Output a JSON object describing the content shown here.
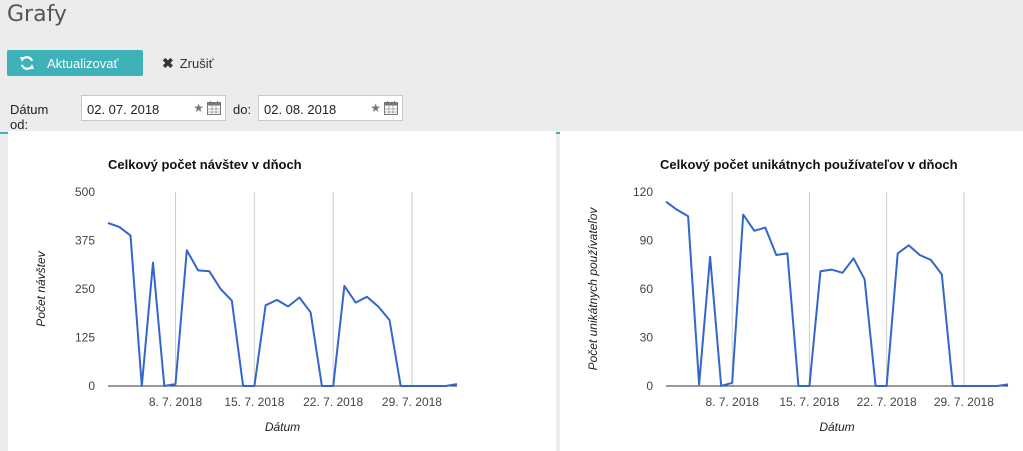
{
  "page": {
    "title": "Grafy"
  },
  "toolbar": {
    "refresh_label": "Aktualizovať",
    "cancel_label": "Zrušiť"
  },
  "filters": {
    "from_label": "Dátum od:",
    "from_value": "02. 07. 2018",
    "to_label": "do:",
    "to_value": "02. 08. 2018"
  },
  "colors": {
    "accent": "#3fb1b8",
    "line": "#3366cc"
  },
  "chart_data": [
    {
      "type": "line",
      "title": "Celkový počet návštev v dňoch",
      "xlabel": "Dátum",
      "ylabel": "Počet návštev",
      "ylim": [
        0,
        500
      ],
      "yticks": [
        "0",
        "125",
        "250",
        "375",
        "500"
      ],
      "xticks": [
        "8. 7. 2018",
        "15. 7. 2018",
        "22. 7. 2018",
        "29. 7. 2018"
      ],
      "x": [
        "2018-07-02",
        "2018-07-03",
        "2018-07-04",
        "2018-07-05",
        "2018-07-06",
        "2018-07-07",
        "2018-07-08",
        "2018-07-09",
        "2018-07-10",
        "2018-07-11",
        "2018-07-12",
        "2018-07-13",
        "2018-07-14",
        "2018-07-15",
        "2018-07-16",
        "2018-07-17",
        "2018-07-18",
        "2018-07-19",
        "2018-07-20",
        "2018-07-21",
        "2018-07-22",
        "2018-07-23",
        "2018-07-24",
        "2018-07-25",
        "2018-07-26",
        "2018-07-27",
        "2018-07-28",
        "2018-07-29",
        "2018-07-30",
        "2018-07-31",
        "2018-08-01",
        "2018-08-02"
      ],
      "values": [
        420,
        410,
        388,
        0,
        318,
        0,
        5,
        350,
        298,
        296,
        250,
        220,
        0,
        0,
        208,
        222,
        205,
        228,
        190,
        0,
        0,
        258,
        215,
        230,
        205,
        170,
        0,
        0,
        0,
        0,
        0,
        5
      ],
      "grid": true
    },
    {
      "type": "line",
      "title": "Celkový počet unikátnych používateľov v dňoch",
      "xlabel": "Dátum",
      "ylabel": "Počet unikátnych používateľov",
      "ylim": [
        0,
        120
      ],
      "yticks": [
        "0",
        "30",
        "60",
        "90",
        "120"
      ],
      "xticks": [
        "8. 7. 2018",
        "15. 7. 2018",
        "22. 7. 2018",
        "29. 7. 2018"
      ],
      "x": [
        "2018-07-02",
        "2018-07-03",
        "2018-07-04",
        "2018-07-05",
        "2018-07-06",
        "2018-07-07",
        "2018-07-08",
        "2018-07-09",
        "2018-07-10",
        "2018-07-11",
        "2018-07-12",
        "2018-07-13",
        "2018-07-14",
        "2018-07-15",
        "2018-07-16",
        "2018-07-17",
        "2018-07-18",
        "2018-07-19",
        "2018-07-20",
        "2018-07-21",
        "2018-07-22",
        "2018-07-23",
        "2018-07-24",
        "2018-07-25",
        "2018-07-26",
        "2018-07-27",
        "2018-07-28",
        "2018-07-29",
        "2018-07-30",
        "2018-07-31",
        "2018-08-01",
        "2018-08-02"
      ],
      "values": [
        114,
        109,
        105,
        1,
        80,
        0,
        2,
        106,
        96,
        98,
        81,
        82,
        0,
        0,
        71,
        72,
        70,
        79,
        66,
        0,
        0,
        82,
        87,
        81,
        78,
        69,
        0,
        0,
        0,
        0,
        0,
        1
      ],
      "grid": true
    }
  ]
}
